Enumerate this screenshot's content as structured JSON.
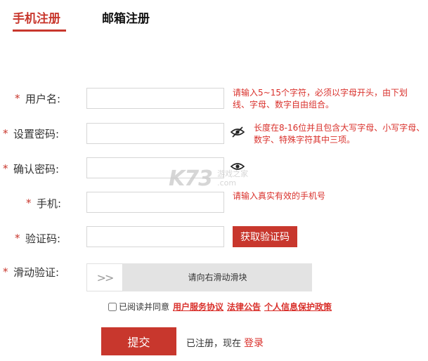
{
  "tabs": {
    "phone": "手机注册",
    "email": "邮箱注册"
  },
  "form": {
    "required_mark": "*",
    "username": {
      "label": "用户名:",
      "value": "",
      "hint": "请输入5~15个字符，必须以字母开头，由下划线、字母、数字自由组合。"
    },
    "password": {
      "label": "设置密码:",
      "value": "",
      "hint": "长度在8-16位并且包含大写字母、小写字母、数字、特殊字符其中三项。"
    },
    "confirm_password": {
      "label": "确认密码:",
      "value": ""
    },
    "phone": {
      "label": "手机:",
      "value": "",
      "hint": "请输入真实有效的手机号"
    },
    "captcha": {
      "label": "验证码:",
      "value": "",
      "button": "获取验证码"
    },
    "slider": {
      "label": "滑动验证:",
      "handle": ">>",
      "text": "请向右滑动滑块"
    }
  },
  "agreement": {
    "checked": false,
    "prefix": "已阅读并同意",
    "links": [
      "用户服务协议",
      "法律公告",
      "个人信息保护政策"
    ]
  },
  "submit_label": "提交",
  "login_prompt": "已注册，现在",
  "login_link": "登录",
  "watermark": {
    "logo": "K73",
    "text": "游戏之家",
    "domain": ".com"
  },
  "colors": {
    "accent": "#c8372d",
    "hint": "#d9302b"
  }
}
